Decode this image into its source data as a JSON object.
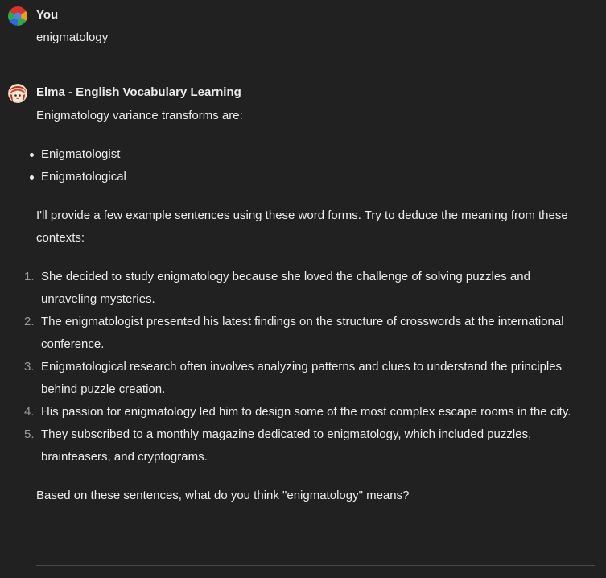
{
  "user_message": {
    "author": "You",
    "text": "enigmatology"
  },
  "bot_message": {
    "author": "Elma - English Vocabulary Learning",
    "intro": "Enigmatology variance transforms are:",
    "forms": [
      "Enigmatologist",
      "Enigmatological"
    ],
    "lead": "I'll provide a few example sentences using these word forms. Try to deduce the meaning from these contexts:",
    "examples": [
      {
        "num": "1.",
        "text": "She decided to study enigmatology because she loved the challenge of solving puzzles and unraveling mysteries."
      },
      {
        "num": "2.",
        "text": "The enigmatologist presented his latest findings on the structure of crosswords at the international conference."
      },
      {
        "num": "3.",
        "text": "Enigmatological research often involves analyzing patterns and clues to understand the principles behind puzzle creation."
      },
      {
        "num": "4.",
        "text": "His passion for enigmatology led him to design some of the most complex escape rooms in the city."
      },
      {
        "num": "5.",
        "text": "They subscribed to a monthly magazine dedicated to enigmatology, which included puzzles, brainteasers, and cryptograms."
      }
    ],
    "question": "Based on these sentences, what do you think \"enigmatology\" means?"
  },
  "colors": {
    "background": "#212121",
    "text": "#ececec",
    "muted": "#9b9b9b",
    "divider": "#4a4a4a"
  }
}
